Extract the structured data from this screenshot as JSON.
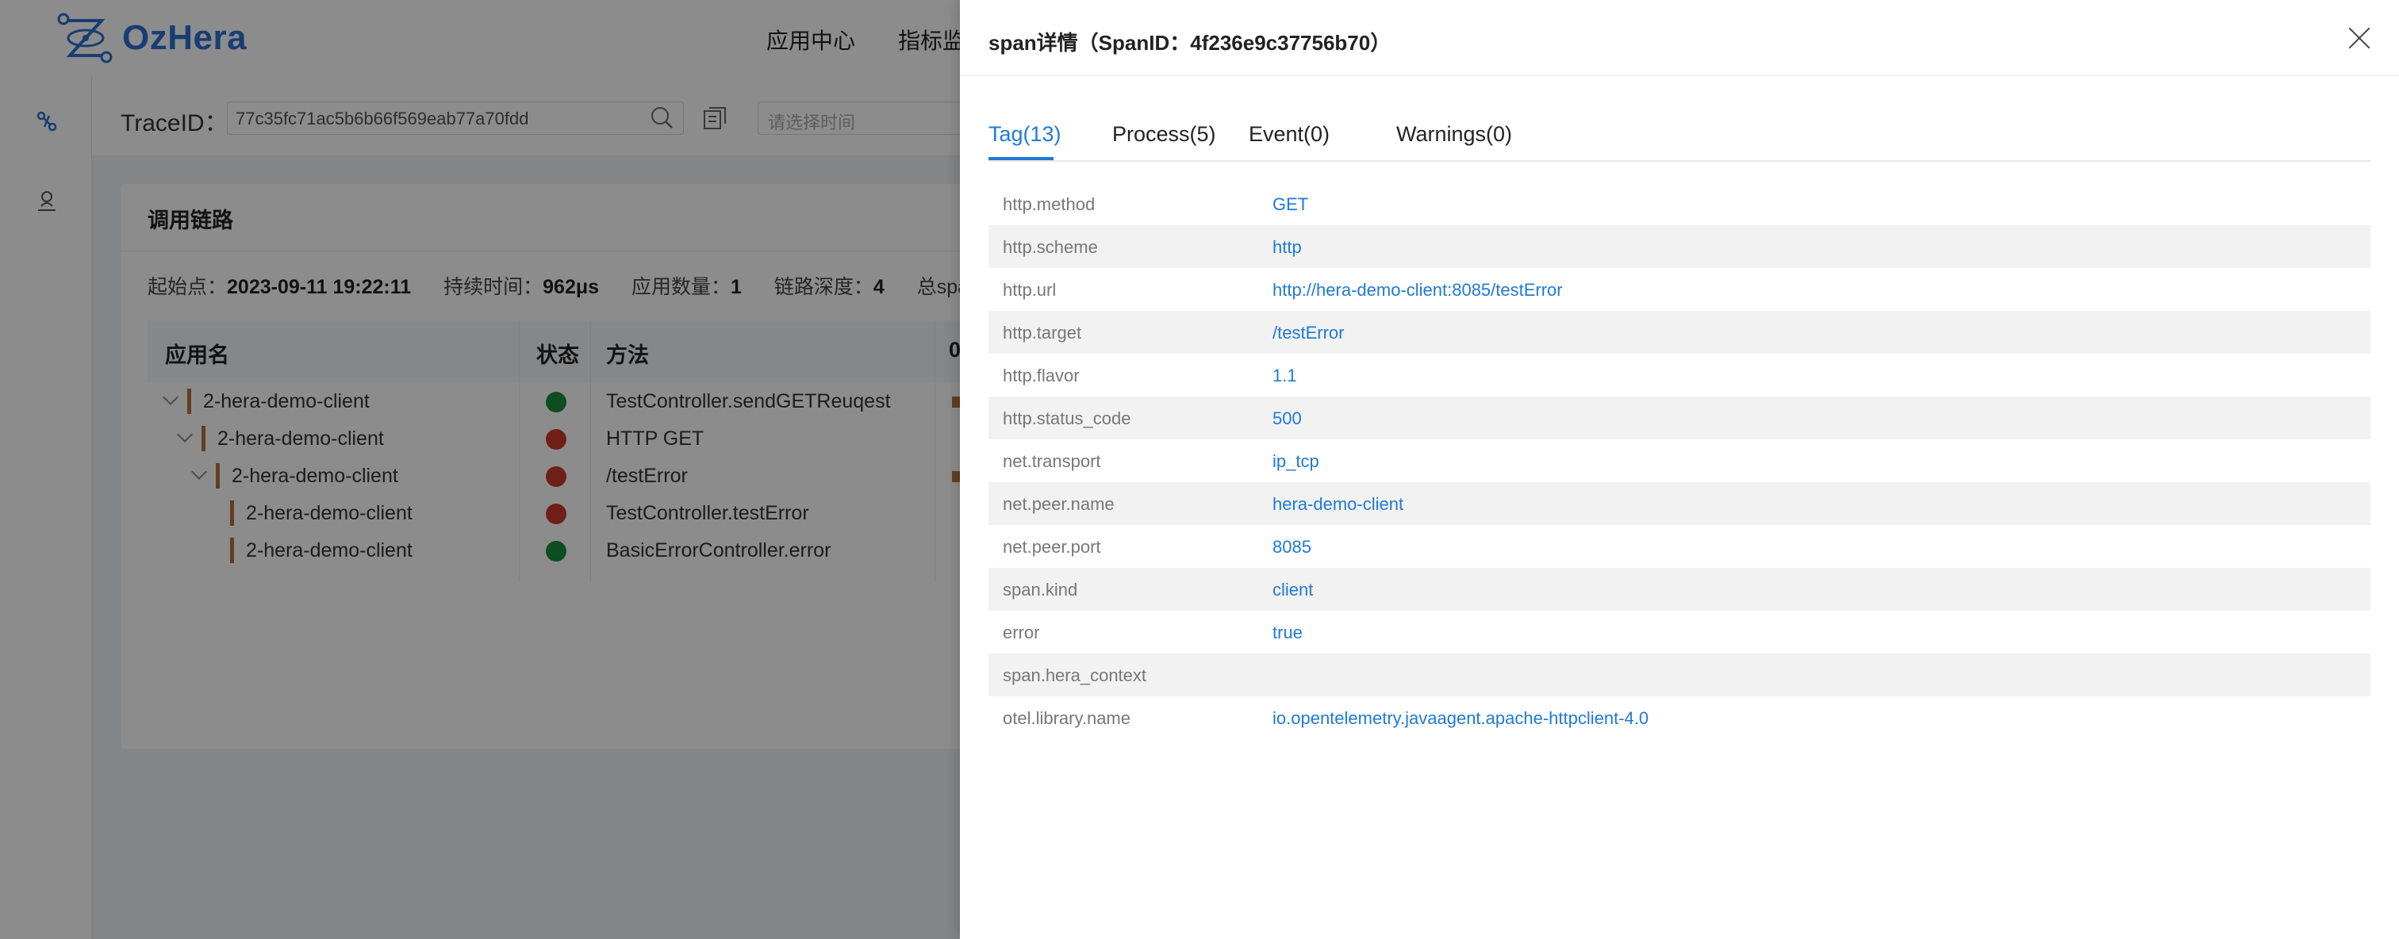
{
  "app": {
    "logo_text": "OzHera",
    "nav": [
      "应用中心",
      "指标监控"
    ]
  },
  "search": {
    "trace_label": "TraceID：",
    "trace_value": "77c35fc71ac5b6b66f569eab77a70fdd",
    "time_placeholder": "请选择时间"
  },
  "chain": {
    "title": "调用链路",
    "start_label": "起始点：",
    "start_value": "2023-09-11 19:22:11",
    "duration_label": "持续时间：",
    "duration_value": "962μs",
    "app_count_label": "应用数量：",
    "app_count_value": "1",
    "depth_label": "链路深度：",
    "depth_value": "4",
    "total_label": "总span",
    "columns": [
      "应用名",
      "状态",
      "方法",
      "0"
    ],
    "rows": [
      {
        "app": "2-hera-demo-client",
        "status": "ok",
        "method": "TestController.sendGETReuqest"
      },
      {
        "app": "2-hera-demo-client",
        "status": "error",
        "method": "HTTP GET"
      },
      {
        "app": "2-hera-demo-client",
        "status": "error",
        "method": "/testError"
      },
      {
        "app": "2-hera-demo-client",
        "status": "error",
        "method": "TestController.testError"
      },
      {
        "app": "2-hera-demo-client",
        "status": "ok",
        "method": "BasicErrorController.error"
      }
    ],
    "status_colors": {
      "ok": "#1a8a3c",
      "error": "#cc3a2b"
    }
  },
  "drawer": {
    "title": "span详情（SpanID：4f236e9c37756b70）",
    "tabs": [
      "Tag(13)",
      "Process(5)",
      "Event(0)",
      "Warnings(0)"
    ],
    "active_tab": "Tag(13)",
    "tags": [
      {
        "key": "http.method",
        "value": "GET"
      },
      {
        "key": "http.scheme",
        "value": "http"
      },
      {
        "key": "http.url",
        "value": "http://hera-demo-client:8085/testError"
      },
      {
        "key": "http.target",
        "value": "/testError"
      },
      {
        "key": "http.flavor",
        "value": "1.1"
      },
      {
        "key": "http.status_code",
        "value": "500"
      },
      {
        "key": "net.transport",
        "value": "ip_tcp"
      },
      {
        "key": "net.peer.name",
        "value": "hera-demo-client"
      },
      {
        "key": "net.peer.port",
        "value": "8085"
      },
      {
        "key": "span.kind",
        "value": "client"
      },
      {
        "key": "error",
        "value": "true"
      },
      {
        "key": "span.hera_context",
        "value": ""
      },
      {
        "key": "otel.library.name",
        "value": "io.opentelemetry.javaagent.apache-httpclient-4.0"
      }
    ]
  },
  "colors": {
    "accent": "#1f7ad6",
    "brand": "#2d6fd0",
    "bar": "#b3723e"
  }
}
